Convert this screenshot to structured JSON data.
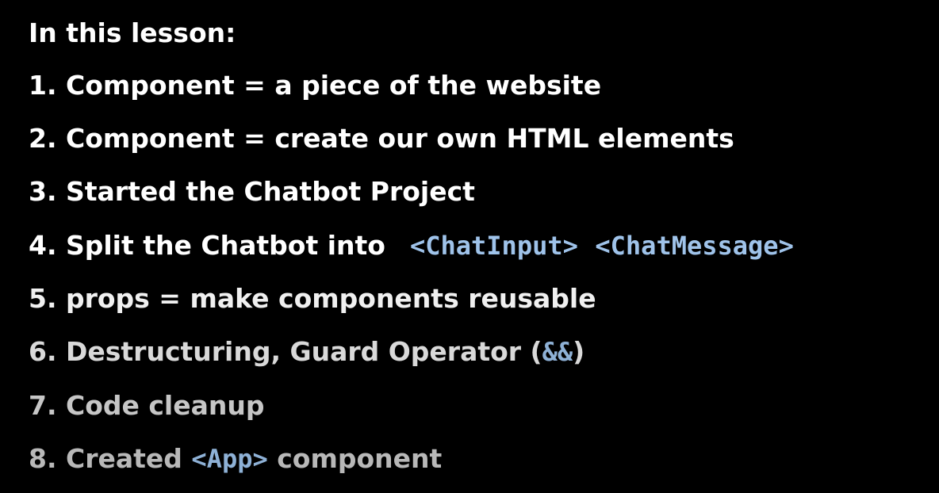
{
  "title": "In this lesson:",
  "items": [
    {
      "text": "1. Component = a piece of the website"
    },
    {
      "text": "2. Component = create our own HTML elements"
    },
    {
      "text": "3. Started the Chatbot Project"
    },
    {
      "text": "4. Split the Chatbot into ",
      "code1": "<ChatInput>",
      "code2": "<ChatMessage>"
    },
    {
      "text": "5. props = make components reusable"
    },
    {
      "text": "6. Destructuring, Guard Operator (",
      "code": "&&",
      "after": ")"
    },
    {
      "text": "7. Code cleanup"
    },
    {
      "text": "8. Created ",
      "code": "<App>",
      "after": " component"
    }
  ],
  "colors": {
    "background": "#000000",
    "text": "#ffffff",
    "code": "#9fc3ea"
  }
}
